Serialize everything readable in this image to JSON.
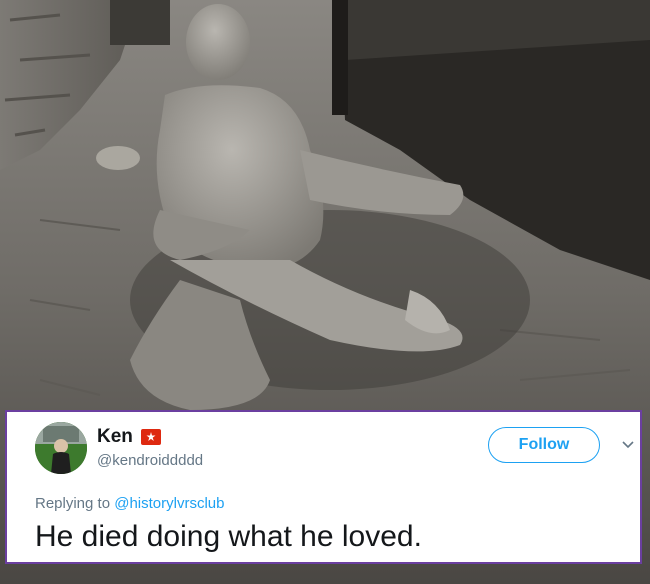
{
  "photo": {
    "icon": "pompeii-body-cast-photo"
  },
  "tweet": {
    "author": {
      "display_name": "Ken",
      "handle": "@kendroiddddd",
      "flag_icon": "hong-kong-flag-icon",
      "avatar_icon": "avatar-photo"
    },
    "follow_label": "Follow",
    "menu_icon": "chevron-down-icon",
    "reply_prefix": "Replying to",
    "reply_mention": "@historylvrsclub",
    "text": "He died doing what he loved."
  },
  "colors": {
    "accent": "#1da1f2",
    "card_border": "#6b3fa0",
    "secondary_text": "#657786",
    "primary_text": "#14171a",
    "flag_red": "#de2910"
  }
}
